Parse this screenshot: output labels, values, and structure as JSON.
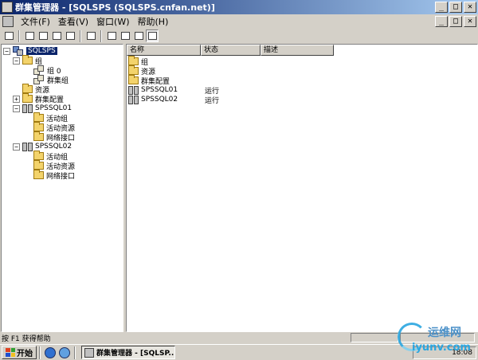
{
  "window": {
    "title": "群集管理器 - [SQLSPS (SQLSPS.cnfan.net)]",
    "controls": [
      "_",
      "□",
      "✕"
    ]
  },
  "menu": {
    "items": [
      "文件(F)",
      "查看(V)",
      "窗口(W)",
      "帮助(H)"
    ],
    "doc_controls": [
      "_",
      "□",
      "✕"
    ]
  },
  "toolbar": {
    "buttons": [
      "connect-icon",
      "properties-icon",
      "stop-icon",
      "delete-icon",
      "new-icon",
      "refresh-icon",
      "large-icons-view-icon",
      "small-icons-view-icon",
      "list-view-icon",
      "details-view-icon"
    ]
  },
  "tree": {
    "root": "SQLSPS",
    "groups_label": "组",
    "group0_label": "组 0",
    "cluster_group_label": "群集组",
    "resources_label": "资源",
    "cluster_config_label": "群集配置",
    "node1": "SPSSQL01",
    "node1_active_groups": "活动组",
    "node1_active_resources": "活动资源",
    "node1_network_interfaces": "网络接口",
    "node2": "SPSSQL02",
    "node2_active_groups": "活动组",
    "node2_active_resources": "活动资源",
    "node2_network_interfaces": "网络接口"
  },
  "list": {
    "columns": [
      "名称",
      "状态",
      "描述"
    ],
    "rows": [
      {
        "name": "组",
        "status": ""
      },
      {
        "name": "资源",
        "status": ""
      },
      {
        "name": "群集配置",
        "status": ""
      },
      {
        "name": "SPSSQL01",
        "status": "运行"
      },
      {
        "name": "SPSSQL02",
        "status": "运行"
      }
    ]
  },
  "statusbar": {
    "text": "按 F1 获得帮助"
  },
  "taskbar": {
    "start_label": "开始",
    "task_label": "群集管理器 - [SQLSP...",
    "clock": "18:08"
  },
  "watermark": {
    "brand": "运维网",
    "url": "iyunv.com"
  },
  "colors": {
    "titlebar_start": "#0a246a",
    "titlebar_end": "#a6caf0",
    "selection": "#0a246a",
    "face": "#d4d0c8"
  }
}
